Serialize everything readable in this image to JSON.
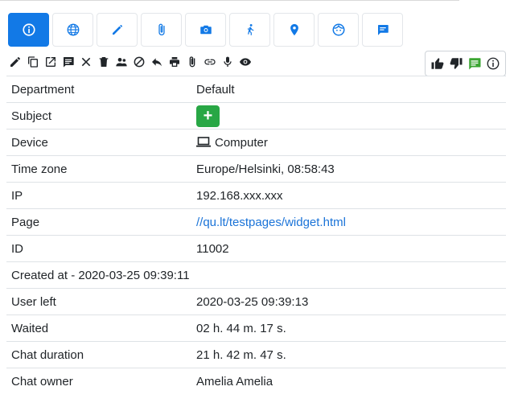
{
  "tabs": [
    {
      "icon": "info-icon",
      "active": true
    },
    {
      "icon": "globe-icon",
      "active": false
    },
    {
      "icon": "pencil-icon",
      "active": false
    },
    {
      "icon": "paperclip-icon",
      "active": false
    },
    {
      "icon": "camera-icon",
      "active": false
    },
    {
      "icon": "walking-person-icon",
      "active": false
    },
    {
      "icon": "location-pin-icon",
      "active": false
    },
    {
      "icon": "face-icon",
      "active": false
    },
    {
      "icon": "chat-bubble-icon",
      "active": false
    }
  ],
  "toolbar_icons": [
    "pencil-icon",
    "copy-icon",
    "open-external-icon",
    "message-icon",
    "close-icon",
    "trash-icon",
    "users-icon",
    "block-icon",
    "reply-icon",
    "print-icon",
    "attachment-icon",
    "link-icon",
    "microphone-icon",
    "eye-icon"
  ],
  "vote_icons": [
    "thumbs-up-icon",
    "thumbs-down-icon",
    "comment-icon",
    "info-icon"
  ],
  "colors": {
    "accent": "#1279e6",
    "success": "#28a745",
    "link": "#1a73d8",
    "comment": "#3aa531"
  },
  "details": {
    "department_label": "Department",
    "department_value": "Default",
    "subject_label": "Subject",
    "subject_button": "+",
    "device_label": "Device",
    "device_value": "Computer",
    "timezone_label": "Time zone",
    "timezone_value": "Europe/Helsinki, 08:58:43",
    "ip_label": "IP",
    "ip_value": "192.168.xxx.xxx",
    "page_label": "Page",
    "page_value": "//qu.lt/testpages/widget.html",
    "id_label": "ID",
    "id_value": "11002",
    "created_text": "Created at - 2020-03-25 09:39:11",
    "user_left_label": "User left",
    "user_left_value": "2020-03-25 09:39:13",
    "waited_label": "Waited",
    "waited_value": "02 h. 44 m. 17 s.",
    "duration_label": "Chat duration",
    "duration_value": "21 h. 42 m. 47 s.",
    "owner_label": "Chat owner",
    "owner_value": "Amelia Amelia"
  }
}
